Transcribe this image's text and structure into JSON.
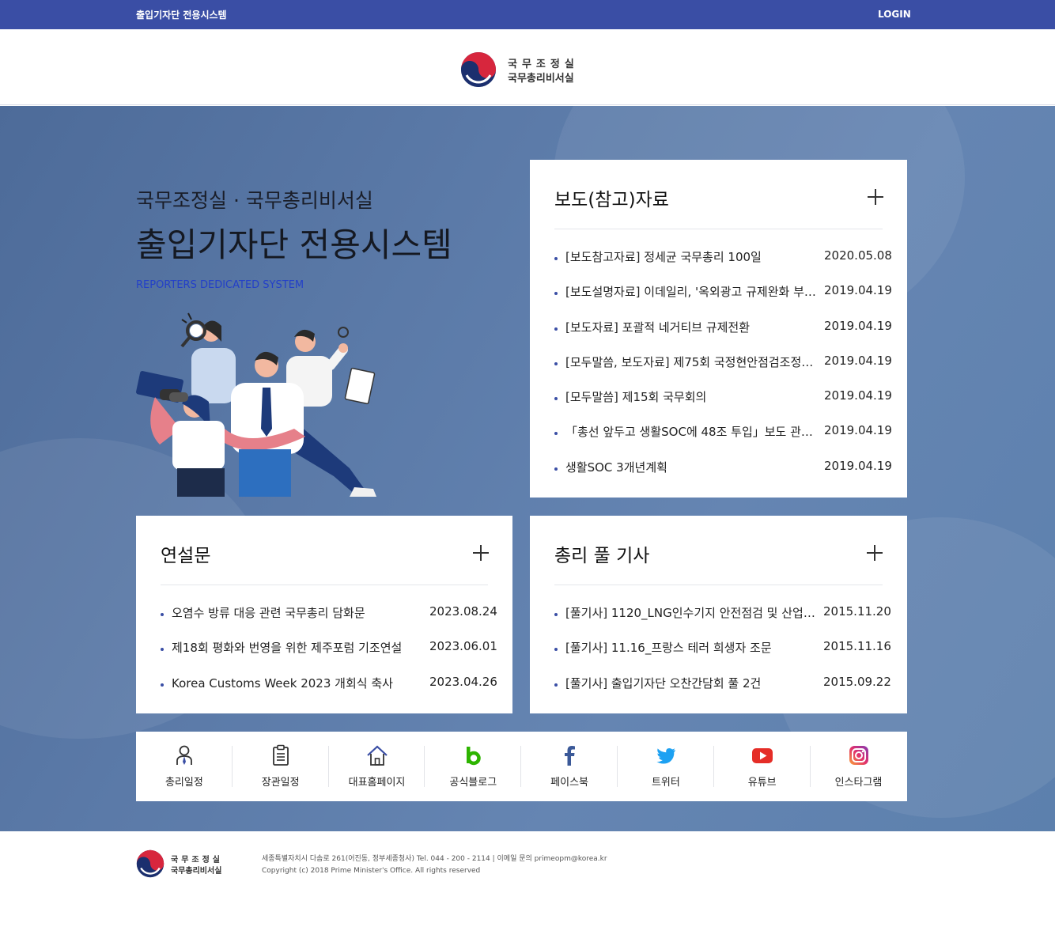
{
  "topbar": {
    "brand": "출입기자단 전용시스템",
    "login": "LOGIN"
  },
  "logo": {
    "line1": "국무조정실",
    "line2": "국무총리비서실"
  },
  "intro": {
    "subtitle": "국무조정실 · 국무총리비서실",
    "title": "출입기자단 전용시스템",
    "english": "REPORTERS DEDICATED SYSTEM"
  },
  "press": {
    "title": "보도(참고)자료",
    "items": [
      {
        "title": "[보도참고자료] 정세균 국무총리 100일",
        "date": "2020.05.08"
      },
      {
        "title": "[보도설명자료] 이데일리, '옥외광고 규제완화 부…",
        "date": "2019.04.19"
      },
      {
        "title": "[보도자료] 포괄적 네거티브 규제전환",
        "date": "2019.04.19"
      },
      {
        "title": "[모두말씀, 보도자료] 제75회 국정현안점검조정…",
        "date": "2019.04.19"
      },
      {
        "title": "[모두말씀] 제15회 국무회의",
        "date": "2019.04.19"
      },
      {
        "title": "「총선 앞두고 생활SOC에 48조 투입」보도 관…",
        "date": "2019.04.19"
      },
      {
        "title": "생활SOC 3개년계획",
        "date": "2019.04.19"
      }
    ]
  },
  "speech": {
    "title": "연설문",
    "items": [
      {
        "title": "오염수 방류 대응 관련 국무총리 담화문",
        "date": "2023.08.24"
      },
      {
        "title": "제18회 평화와 번영을 위한 제주포럼 기조연설",
        "date": "2023.06.01"
      },
      {
        "title": "Korea Customs Week 2023 개회식 축사",
        "date": "2023.04.26"
      }
    ]
  },
  "pool": {
    "title": "총리 풀 기사",
    "items": [
      {
        "title": "[풀기사] 1120_LNG인수기지 안전점검 및 산업…",
        "date": "2015.11.20"
      },
      {
        "title": "[풀기사] 11.16_프랑스 테러 희생자 조문",
        "date": "2015.11.16"
      },
      {
        "title": "[풀기사] 출입기자단 오찬간담회 풀 2건",
        "date": "2015.09.22"
      }
    ]
  },
  "quicklinks": [
    {
      "label": "총리일정",
      "icon": "person-icon"
    },
    {
      "label": "장관일정",
      "icon": "clipboard-icon"
    },
    {
      "label": "대표홈페이지",
      "icon": "home-icon"
    },
    {
      "label": "공식블로그",
      "icon": "blog-icon"
    },
    {
      "label": "페이스북",
      "icon": "facebook-icon"
    },
    {
      "label": "트위터",
      "icon": "twitter-icon"
    },
    {
      "label": "유튜브",
      "icon": "youtube-icon"
    },
    {
      "label": "인스타그램",
      "icon": "instagram-icon"
    }
  ],
  "footer": {
    "logo_line1": "국무조정실",
    "logo_line2": "국무총리비서실",
    "address": "세종특별자치시 다솜로 261(어진동, 정부세종청사) Tel. 044 - 200 - 2114 | 이메일 문의 primeopm@korea.kr",
    "copyright": "Copyright (c) 2018 Prime Minister's Office. All rights reserved"
  },
  "colors": {
    "topbar": "#3a4ea5",
    "accent": "#2340c8",
    "hero": "#5b7aa8"
  }
}
